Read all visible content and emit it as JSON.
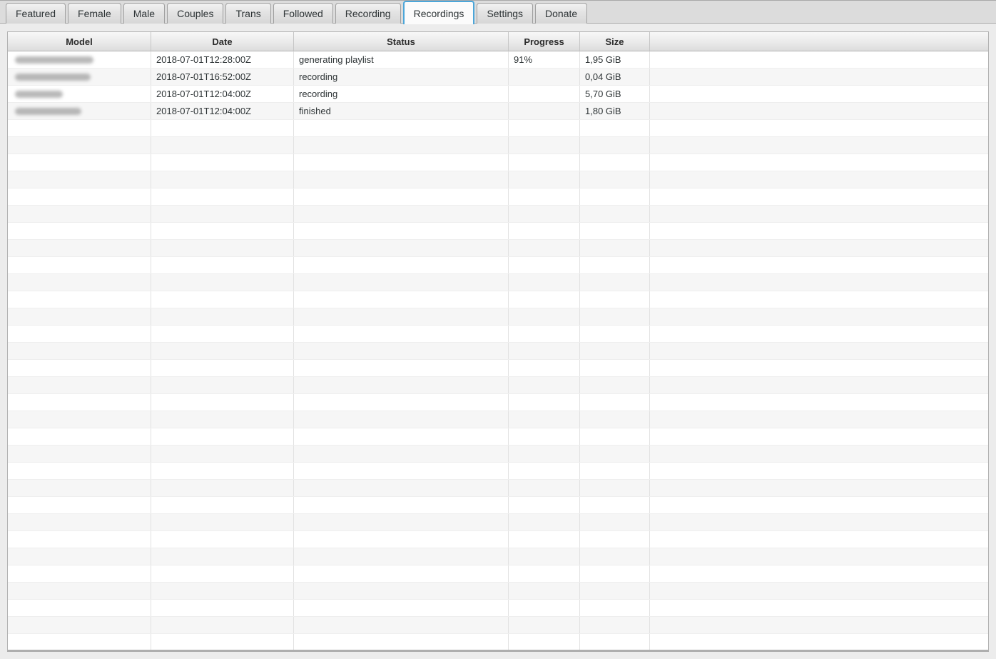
{
  "tabs": {
    "items": [
      {
        "label": "Featured",
        "active": false
      },
      {
        "label": "Female",
        "active": false
      },
      {
        "label": "Male",
        "active": false
      },
      {
        "label": "Couples",
        "active": false
      },
      {
        "label": "Trans",
        "active": false
      },
      {
        "label": "Followed",
        "active": false
      },
      {
        "label": "Recording",
        "active": false
      },
      {
        "label": "Recordings",
        "active": true
      },
      {
        "label": "Settings",
        "active": false
      },
      {
        "label": "Donate",
        "active": false
      }
    ]
  },
  "table": {
    "columns": [
      "Model",
      "Date",
      "Status",
      "Progress",
      "Size"
    ],
    "rows": [
      {
        "model": "",
        "model_blurred": true,
        "date": "2018-07-01T12:28:00Z",
        "status": "generating playlist",
        "progress": "91%",
        "size": "1,95 GiB"
      },
      {
        "model": "",
        "model_blurred": true,
        "date": "2018-07-01T16:52:00Z",
        "status": "recording",
        "progress": "",
        "size": "0,04 GiB"
      },
      {
        "model": "",
        "model_blurred": true,
        "date": "2018-07-01T12:04:00Z",
        "status": "recording",
        "progress": "",
        "size": "5,70 GiB"
      },
      {
        "model": "",
        "model_blurred": true,
        "date": "2018-07-01T12:04:00Z",
        "status": "finished",
        "progress": "",
        "size": "1,80 GiB"
      }
    ],
    "empty_row_count": 31
  },
  "colors": {
    "active_tab_border": "#4ba6d9",
    "window_background": "#ececec",
    "tab_strip_background": "#dcdcdc",
    "row_stripe": "#f6f6f6",
    "header_text": "#2b2b2b",
    "body_text": "#2e3436"
  }
}
